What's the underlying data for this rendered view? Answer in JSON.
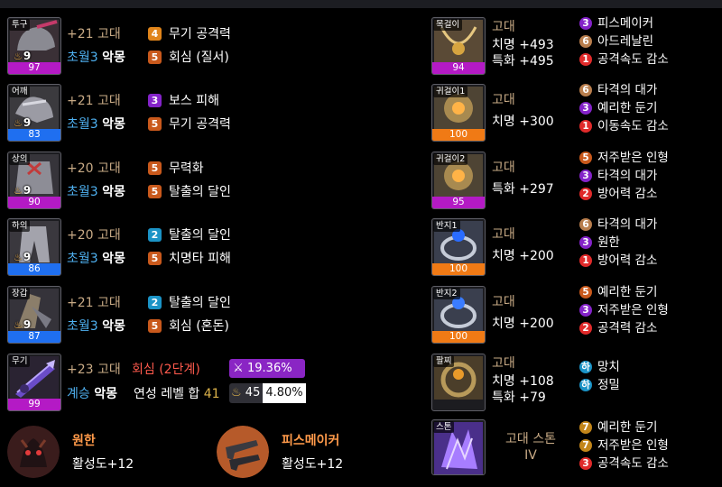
{
  "equipment": [
    {
      "slot": "투구",
      "level": "9",
      "quality": "97",
      "q_class": "q-purple",
      "line1_plus": "+21",
      "line1_grade": "고대",
      "line2_prefix": "초월3",
      "line2_suffix": "악몽",
      "opt1": {
        "num": "4",
        "text": "무기 공격력",
        "color": "b-orange"
      },
      "opt2": {
        "num": "5",
        "text": "회심 (질서)",
        "color": "b-brown"
      }
    },
    {
      "slot": "어깨",
      "level": "9",
      "quality": "83",
      "q_class": "q-blue",
      "line1_plus": "+21",
      "line1_grade": "고대",
      "line2_prefix": "초월3",
      "line2_suffix": "악몽",
      "opt1": {
        "num": "3",
        "text": "보스 피해",
        "color": "b-purple"
      },
      "opt2": {
        "num": "5",
        "text": "무기 공격력",
        "color": "b-brown"
      }
    },
    {
      "slot": "상의",
      "level": "9",
      "quality": "90",
      "q_class": "q-purple",
      "line1_plus": "+20",
      "line1_grade": "고대",
      "line2_prefix": "초월3",
      "line2_suffix": "악몽",
      "opt1": {
        "num": "5",
        "text": "무력화",
        "color": "b-brown"
      },
      "opt2": {
        "num": "5",
        "text": "탈출의 달인",
        "color": "b-brown"
      }
    },
    {
      "slot": "하의",
      "level": "9",
      "quality": "86",
      "q_class": "q-blue",
      "line1_plus": "+20",
      "line1_grade": "고대",
      "line2_prefix": "초월3",
      "line2_suffix": "악몽",
      "opt1": {
        "num": "2",
        "text": "탈출의 달인",
        "color": "b-teal"
      },
      "opt2": {
        "num": "5",
        "text": "치명타 피해",
        "color": "b-brown"
      }
    },
    {
      "slot": "장갑",
      "level": "9",
      "quality": "87",
      "q_class": "q-blue",
      "line1_plus": "+21",
      "line1_grade": "고대",
      "line2_prefix": "초월3",
      "line2_suffix": "악몽",
      "opt1": {
        "num": "2",
        "text": "탈출의 달인",
        "color": "b-teal"
      },
      "opt2": {
        "num": "5",
        "text": "회심 (혼돈)",
        "color": "b-brown"
      }
    }
  ],
  "weapon": {
    "slot": "무기",
    "quality": "99",
    "plus": "+23",
    "grade": "고대",
    "special": "회심 (2단계)",
    "line2_prefix": "계승",
    "line2_suffix": "악몽",
    "elixir_label": "연성 레벨 합",
    "elixir_value": "41",
    "pill1": "19.36%",
    "pill2_level": "45",
    "pill2_pct": "4.80%"
  },
  "accessories": [
    {
      "slot": "목걸이",
      "quality": "94",
      "q_class": "q-purple",
      "grade": "고대",
      "stats": [
        "치명 +493",
        "특화 +495"
      ],
      "engravings": [
        {
          "num": "3",
          "text": "피스메이커",
          "color": "b-purple"
        },
        {
          "num": "6",
          "text": "아드레날린",
          "color": "b-tan"
        },
        {
          "num": "1",
          "text": "공격속도 감소",
          "color": "b-red"
        }
      ]
    },
    {
      "slot": "귀걸이1",
      "quality": "100",
      "q_class": "q-orange",
      "grade": "고대",
      "stats": [
        "치명 +300"
      ],
      "engravings": [
        {
          "num": "6",
          "text": "타격의 대가",
          "color": "b-tan"
        },
        {
          "num": "3",
          "text": "예리한 둔기",
          "color": "b-purple"
        },
        {
          "num": "1",
          "text": "이동속도 감소",
          "color": "b-red"
        }
      ]
    },
    {
      "slot": "귀걸이2",
      "quality": "95",
      "q_class": "q-purple",
      "grade": "고대",
      "stats": [
        "특화 +297"
      ],
      "engravings": [
        {
          "num": "5",
          "text": "저주받은 인형",
          "color": "b-brown"
        },
        {
          "num": "3",
          "text": "타격의 대가",
          "color": "b-purple"
        },
        {
          "num": "2",
          "text": "방어력 감소",
          "color": "b-red"
        }
      ]
    },
    {
      "slot": "반지1",
      "quality": "100",
      "q_class": "q-orange",
      "grade": "고대",
      "stats": [
        "치명 +200"
      ],
      "engravings": [
        {
          "num": "6",
          "text": "타격의 대가",
          "color": "b-tan"
        },
        {
          "num": "3",
          "text": "원한",
          "color": "b-purple"
        },
        {
          "num": "1",
          "text": "방어력 감소",
          "color": "b-red"
        }
      ]
    },
    {
      "slot": "반지2",
      "quality": "100",
      "q_class": "q-orange",
      "grade": "고대",
      "stats": [
        "치명 +200"
      ],
      "engravings": [
        {
          "num": "5",
          "text": "예리한 둔기",
          "color": "b-brown"
        },
        {
          "num": "3",
          "text": "저주받은 인형",
          "color": "b-purple"
        },
        {
          "num": "2",
          "text": "공격력 감소",
          "color": "b-red"
        }
      ]
    },
    {
      "slot": "팔찌",
      "quality": "",
      "q_class": "",
      "grade": "고대",
      "stats": [
        "치명 +108",
        "특화 +79"
      ],
      "engravings": [
        {
          "num": "하",
          "text": "망치",
          "color": "b-teal"
        },
        {
          "num": "하",
          "text": "정밀",
          "color": "b-teal"
        }
      ]
    }
  ],
  "stone": {
    "slot": "스톤",
    "grade_line1": "고대 스톤",
    "grade_line2": "IV",
    "engravings": [
      {
        "num": "7",
        "text": "예리한 둔기",
        "color": "b-gold"
      },
      {
        "num": "7",
        "text": "저주받은 인형",
        "color": "b-gold"
      },
      {
        "num": "3",
        "text": "공격속도 감소",
        "color": "b-red"
      }
    ]
  },
  "awakening": [
    {
      "name": "원한",
      "value": "활성도+12",
      "icon": "grudge-icon"
    },
    {
      "name": "피스메이커",
      "value": "활성도+12",
      "icon": "peacemaker-icon"
    }
  ]
}
